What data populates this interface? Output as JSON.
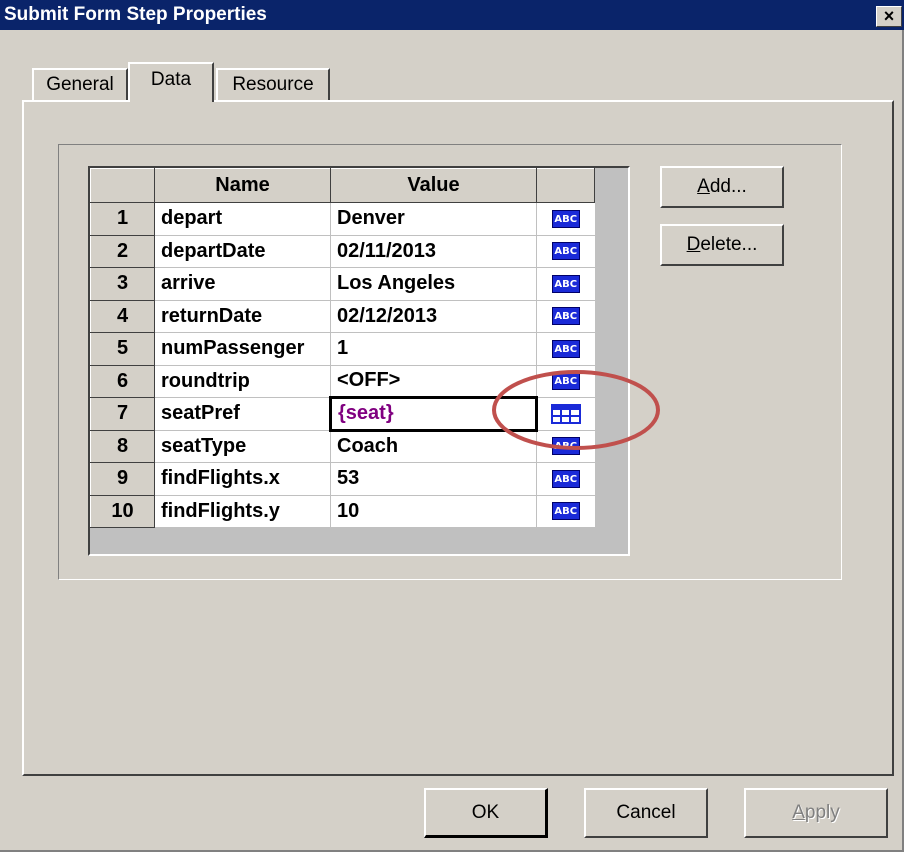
{
  "window": {
    "title": "Submit Form Step Properties",
    "close_glyph": "×"
  },
  "tabs": [
    {
      "label": "General"
    },
    {
      "label": "Data"
    },
    {
      "label": "Resource"
    }
  ],
  "grid": {
    "headers": {
      "num": "",
      "name": "Name",
      "value": "Value",
      "icon": ""
    },
    "rows": [
      {
        "num": "1",
        "name": "depart",
        "value": "Denver",
        "icon": "abc-icon"
      },
      {
        "num": "2",
        "name": "departDate",
        "value": "02/11/2013",
        "icon": "abc-icon"
      },
      {
        "num": "3",
        "name": "arrive",
        "value": "Los Angeles",
        "icon": "abc-icon"
      },
      {
        "num": "4",
        "name": "returnDate",
        "value": "02/12/2013",
        "icon": "abc-icon"
      },
      {
        "num": "5",
        "name": "numPassenger",
        "value": "1",
        "icon": "abc-icon"
      },
      {
        "num": "6",
        "name": "roundtrip",
        "value": "<OFF>",
        "icon": "abc-icon"
      },
      {
        "num": "7",
        "name": "seatPref",
        "value": "{seat}",
        "icon": "table-icon"
      },
      {
        "num": "8",
        "name": "seatType",
        "value": "Coach",
        "icon": "abc-icon"
      },
      {
        "num": "9",
        "name": "findFlights.x",
        "value": "53",
        "icon": "abc-icon"
      },
      {
        "num": "10",
        "name": "findFlights.y",
        "value": "10",
        "icon": "abc-icon"
      }
    ],
    "abc_icon_text": "ABC",
    "selected_value_color": "#800080"
  },
  "buttons": {
    "add": {
      "mnemonic": "A",
      "rest": "dd..."
    },
    "delete": {
      "mnemonic": "D",
      "rest": "elete..."
    },
    "ok": "OK",
    "cancel": "Cancel",
    "apply": {
      "mnemonic": "A",
      "rest": "pply"
    }
  },
  "colors": {
    "titlebar": "#0a246a",
    "dialog_bg": "#d4d0c8",
    "abc_icon": "#1a2ad8",
    "highlight_ring": "#c0504d"
  }
}
